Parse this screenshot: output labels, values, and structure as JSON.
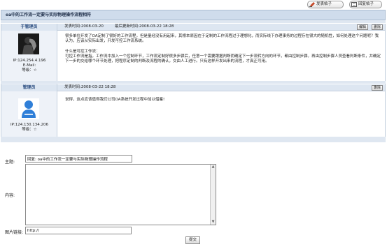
{
  "toolbar": {
    "new_post_label": "发表帖子",
    "reply_label": "回复帖子"
  },
  "thread": {
    "title": "oa中的工作流一定要与实际物理操作流程相符"
  },
  "posts": [
    {
      "author": "于管理员",
      "ip": "IP:124.254.4.196",
      "email": "E-Mail:",
      "level": "等级：☆",
      "posted": "发表时间:2008-03-20",
      "updated": "最后更新时间:2008-03-22 18:28",
      "edit_label": "编辑",
      "delete_label": "删除",
      "content": "很多单位开发了OA定制了很好的工作流程，但是量经没有用起来，其根本原因在于定制的工作流程过于理想化，而实际线下办理事务的过程存在很大的随机性，如何处理这个问题呢？我认为，应该从实际出发，开发可控工作流系统。\n\n什么是可控工作流：\n可控工作流是指，工作流中加入一个控制环节，工作流定制好很多步骤后，任意一个需要跟据判断而确定下一步流转方向的环节，都由控制步骤。再由控制步骤人员查看判断条件，并确定下一步的交给哪个环节处理，把程序定制的判断及流程的确认，交由人工进行。只有这样开发出来的流程，才真正可用。"
    },
    {
      "author": "管理员",
      "ip": "IP:124.130.134.206",
      "level": "等级：☆",
      "posted": "发表时间:2008-03-22 18:28",
      "delete_label": "删除",
      "content": "说得，这点应该值得我们公司OA系统开发过程中加以借鉴!"
    }
  ],
  "form": {
    "subject_label": "主题:",
    "subject_value": "回复: oa中的工作流一定要与实际物理操作流程",
    "content_label": "内容:",
    "image_label": "图片链接:",
    "image_value": "http://",
    "submit_label": "提交"
  },
  "colors": {
    "title_bg": "#cfdcec",
    "author_bg": "#eef2f8",
    "author_name": "#2b4d80"
  },
  "icons": [
    "new-post-icon",
    "reply-icon",
    "avatar-icon"
  ]
}
